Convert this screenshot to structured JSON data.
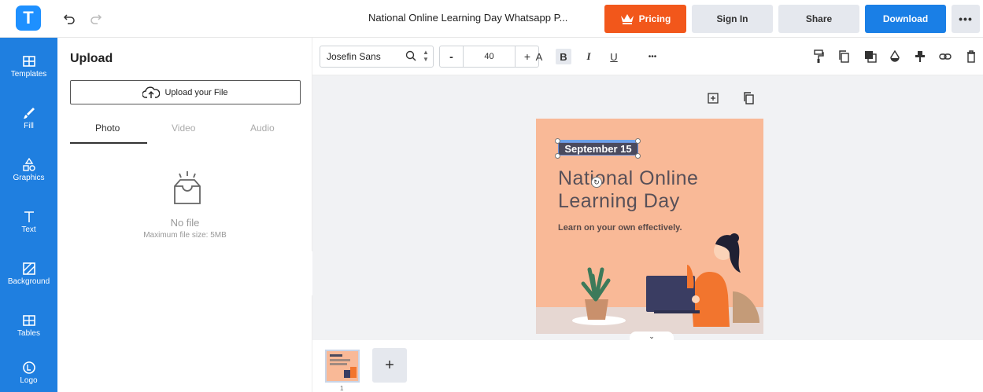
{
  "header": {
    "logo_letter": "T",
    "undo_icon": "undo-icon",
    "redo_icon": "redo-icon",
    "doc_title": "National Online Learning Day Whatsapp P...",
    "pricing_label": "Pricing",
    "signin_label": "Sign In",
    "share_label": "Share",
    "download_label": "Download",
    "more_label": "•••"
  },
  "sidebar": {
    "items": [
      {
        "label": "Templates",
        "icon": "templates-icon"
      },
      {
        "label": "Fill",
        "icon": "brush-icon"
      },
      {
        "label": "Graphics",
        "icon": "shapes-icon"
      },
      {
        "label": "Text",
        "icon": "text-icon"
      },
      {
        "label": "Background",
        "icon": "background-icon"
      },
      {
        "label": "Tables",
        "icon": "table-icon"
      },
      {
        "label": "Logo",
        "icon": "logo-icon"
      }
    ]
  },
  "panel": {
    "title": "Upload",
    "upload_label": "Upload your File",
    "tabs": [
      "Photo",
      "Video",
      "Audio"
    ],
    "empty_text": "No file",
    "max_size_text": "Maximum file size: 5MB"
  },
  "toolbar": {
    "font_family": "Josefin Sans",
    "font_size": "40",
    "minus_label": "-",
    "plus_label": "+",
    "case_label": "A",
    "bold_label": "B",
    "italic_label": "I",
    "underline_label": "U",
    "more_label": "•••"
  },
  "design": {
    "date": "September 15",
    "title": "National Online Learning Day",
    "subtitle": "Learn on your own effectively."
  },
  "pages": {
    "page_number": "1",
    "add_label": "+"
  },
  "colors": {
    "brand_blue": "#1f7fe0",
    "pricing_orange": "#f2571b",
    "design_bg": "#f9b997"
  }
}
